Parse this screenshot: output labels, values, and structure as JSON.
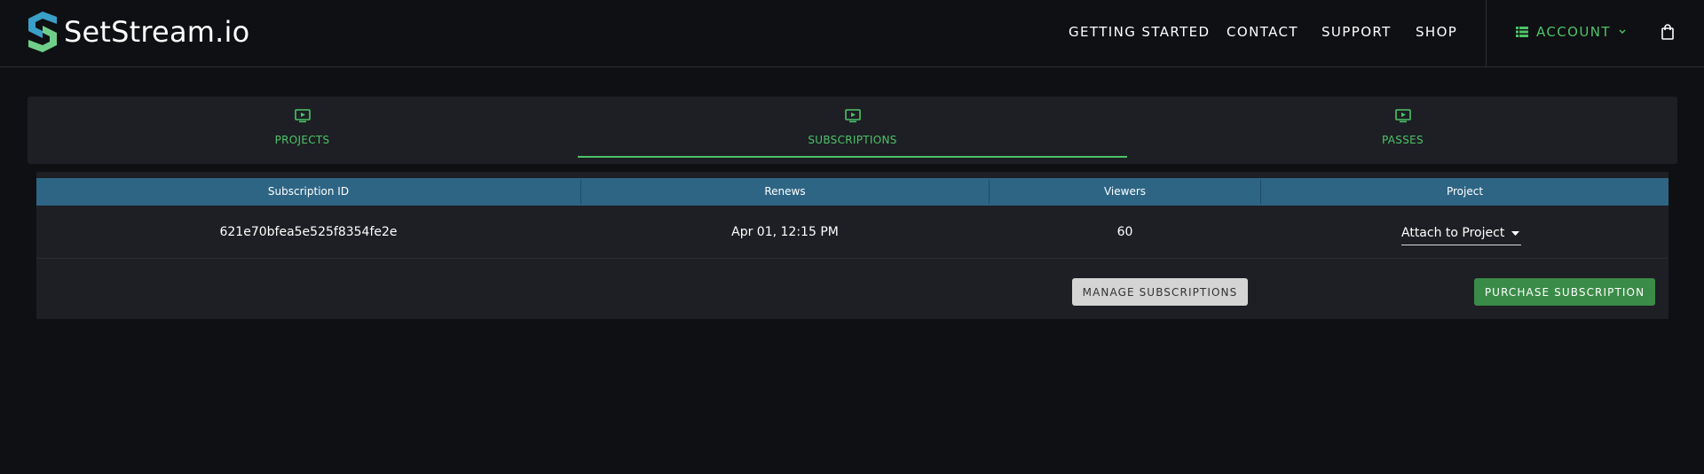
{
  "brand": {
    "name": "SetStream.io",
    "logo_icon": "setstream-s-logo",
    "accent": "#4cc368"
  },
  "nav": {
    "items": [
      "GETTING STARTED",
      "CONTACT",
      "SUPPORT",
      "SHOP"
    ],
    "account_label": "ACCOUNT",
    "account_icon": "list-icon",
    "cart_icon": "shopping-bag-icon"
  },
  "tabs": [
    {
      "label": "PROJECTS",
      "icon": "tv-play-icon",
      "active": false
    },
    {
      "label": "SUBSCRIPTIONS",
      "icon": "tv-play-icon",
      "active": true
    },
    {
      "label": "PASSES",
      "icon": "tv-play-icon",
      "active": false
    }
  ],
  "table": {
    "header_color": "#2e6585",
    "columns": [
      "Subscription ID",
      "Renews",
      "Viewers",
      "Project"
    ],
    "rows": [
      {
        "id": "621e70bfea5e525f8354fe2e",
        "renews": "Apr 01, 12:15 PM",
        "viewers": "60",
        "project": "Attach to Project"
      }
    ]
  },
  "actions": {
    "manage_label": "MANAGE SUBSCRIPTIONS",
    "purchase_label": "PURCHASE SUBSCRIPTION",
    "purchase_color": "#3a8b47"
  }
}
